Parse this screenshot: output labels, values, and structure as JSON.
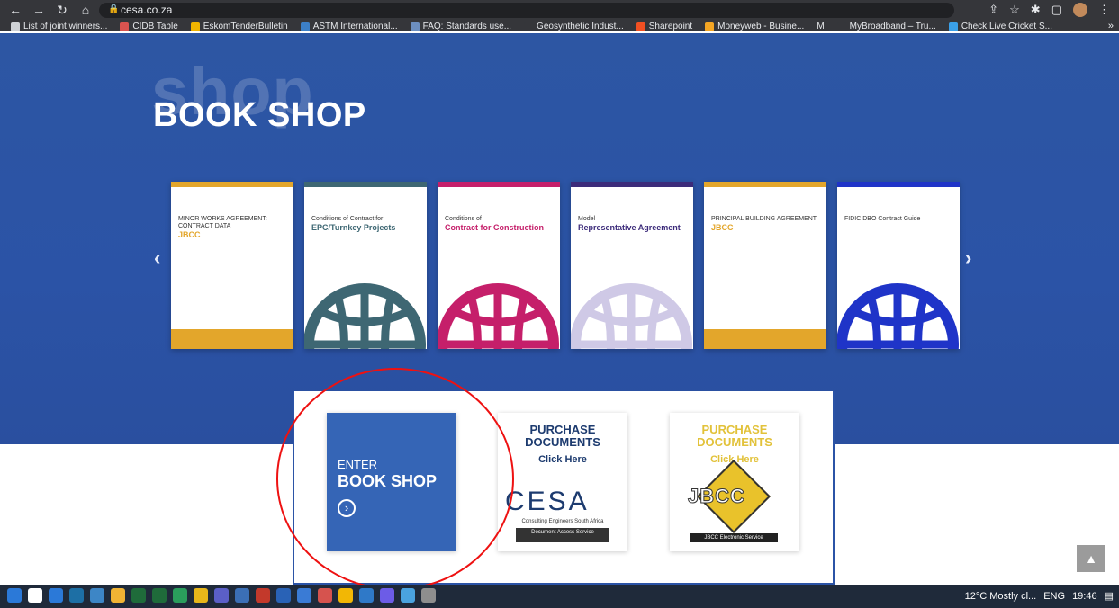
{
  "browser": {
    "url": "cesa.co.za",
    "bookmarks": [
      {
        "label": "List of joint winners...",
        "color": "#cfd2d6"
      },
      {
        "label": "CIDB Table",
        "color": "#d9534f"
      },
      {
        "label": "EskomTenderBulletin",
        "color": "#f0b400"
      },
      {
        "label": "ASTM International...",
        "color": "#3c7fc6"
      },
      {
        "label": "FAQ: Standards use...",
        "color": "#6c8ebf"
      },
      {
        "label": "Geosynthetic Indust...",
        "color": "#35363a"
      },
      {
        "label": "Sharepoint",
        "color": "#f25022"
      },
      {
        "label": "Moneyweb - Busine...",
        "color": "#f5a623"
      },
      {
        "label": "MyBroadband – Tru...",
        "color": "#35363a"
      },
      {
        "label": "Check Live Cricket S...",
        "color": "#3aa0e8"
      }
    ],
    "bookmark_more": "»",
    "m_icon": "M"
  },
  "hero": {
    "ghost_text": "shop",
    "title": "BOOK SHOP",
    "prev_arrow": "‹",
    "next_arrow": "›"
  },
  "books": [
    {
      "title": "MINOR WORKS AGREEMENT: CONTRACT DATA",
      "subtitle": "JBCC",
      "accent": "#e3a62b",
      "globe": "none"
    },
    {
      "title": "Conditions of Contract for",
      "subtitle": "EPC/Turnkey Projects",
      "accent": "#3e6773",
      "globe": "#3e6773"
    },
    {
      "title": "Conditions of",
      "subtitle": "Contract for Construction",
      "accent": "#c51f6a",
      "globe": "#c51f6a"
    },
    {
      "title": "Model",
      "subtitle": "Representative Agreement",
      "accent": "#3c2b7a",
      "globe": "#cfc9e6"
    },
    {
      "title": "PRINCIPAL BUILDING AGREEMENT",
      "subtitle": "JBCC",
      "accent": "#e3a62b",
      "globe": "none"
    },
    {
      "title": "FIDIC DBO Contract Guide",
      "subtitle": "",
      "accent": "#1f34c8",
      "globe": "#1f34c8"
    }
  ],
  "cards": {
    "enter": {
      "line1": "ENTER",
      "line2": "BOOK SHOP",
      "icon": "›"
    },
    "cesa": {
      "title": "PURCHASE DOCUMENTS",
      "click": "Click Here",
      "logo": "CESA",
      "sub": "Consulting Engineers South Africa",
      "bar": "Document Access Service",
      "title_color": "#1d3b6f"
    },
    "jbcc": {
      "title": "PURCHASE DOCUMENTS",
      "click": "Click Here",
      "logo": "JBCC",
      "bar": "JBCC Electronic Service",
      "title_color": "#e2c23a"
    }
  },
  "scroll_top": "▲",
  "taskbar": {
    "weather": "12°C  Mostly cl...",
    "lang": "ENG",
    "time": "19:46",
    "icons": [
      "#2b79d8",
      "#ffffff",
      "#2b79d8",
      "#1d6fa5",
      "#3d86c6",
      "#f1b434",
      "#1f6b3a",
      "#1f6b3a",
      "#2a9d5c",
      "#e8b71a",
      "#5b5fc7",
      "#3b6fb6",
      "#c3392b",
      "#2962b6",
      "#3a7bd5",
      "#d6534e",
      "#f2b705",
      "#2f79c8",
      "#6c5ce7",
      "#4aa3df",
      "#8e8e8e"
    ]
  }
}
